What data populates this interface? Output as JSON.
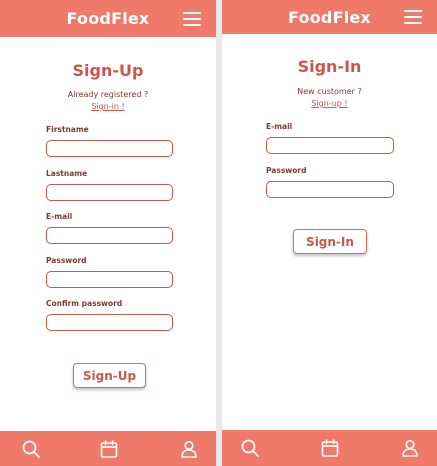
{
  "signup": {
    "brand": "FoodFlex",
    "title": "Sign-Up",
    "already_text": "Already registered ?",
    "signin_link": "Sign-in !",
    "fields": {
      "firstname": {
        "label": "Firstname",
        "value": "",
        "placeholder": ""
      },
      "lastname": {
        "label": "Lastname",
        "value": "",
        "placeholder": ""
      },
      "email": {
        "label": "E-mail",
        "value": "",
        "placeholder": ""
      },
      "password": {
        "label": "Password",
        "value": "",
        "placeholder": ""
      },
      "confirm": {
        "label": "Confirm password",
        "value": "",
        "placeholder": ""
      }
    },
    "button_label": "Sign-Up"
  },
  "signin": {
    "brand": "FoodFlex",
    "title": "Sign-In",
    "new_text": "New customer ?",
    "signup_link": "Sign-up !",
    "fields": {
      "email": {
        "label": "E-mail",
        "value": "",
        "placeholder": ""
      },
      "password": {
        "label": "Password",
        "value": "",
        "placeholder": ""
      }
    },
    "button_label": "Sign-In"
  },
  "nav_icons": [
    "search-icon",
    "calendar-icon",
    "user-icon"
  ],
  "colors": {
    "brand": "#ef7a69",
    "accent_text": "#c9574a",
    "muted_text": "#7a3b33",
    "background": "#ffffff"
  }
}
